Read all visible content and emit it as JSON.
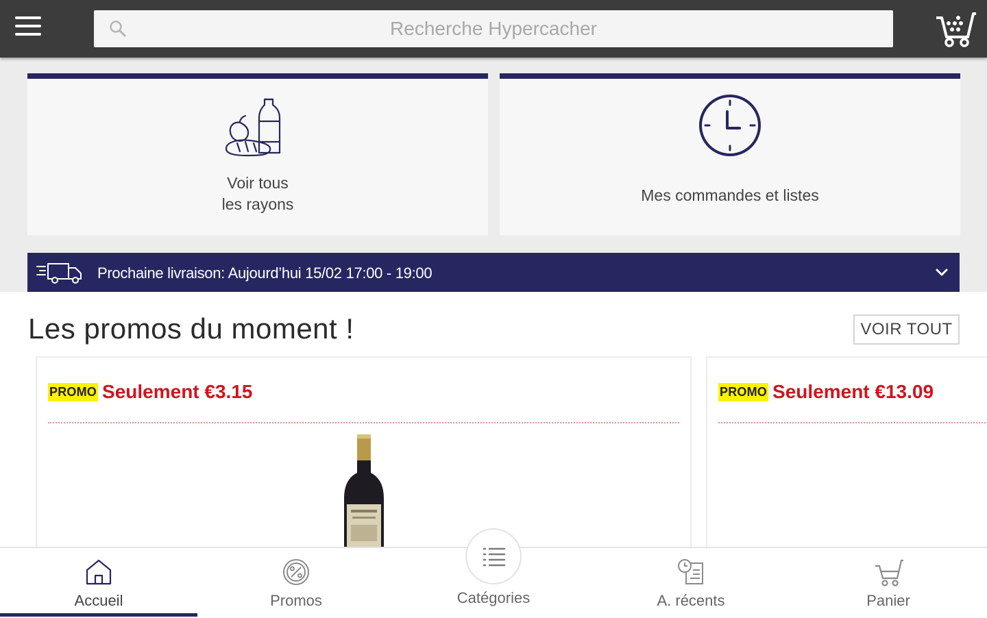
{
  "header": {
    "menu_icon": "hamburger-menu-icon",
    "search_placeholder": "Recherche Hypercacher",
    "cart_icon": "shopping-cart-icon"
  },
  "tiles": {
    "left": {
      "icon": "groceries-icon",
      "label_line1": "Voir tous",
      "label_line2": "les rayons"
    },
    "right": {
      "icon": "clock-icon",
      "label": "Mes commandes et listes"
    }
  },
  "delivery": {
    "icon": "delivery-truck-icon",
    "text": "Prochaine livraison: Aujourd’hui 15/02 17:00 - 19:00"
  },
  "promos": {
    "title": "Les promos du moment !",
    "see_all": "VOIR TOUT",
    "cards": [
      {
        "badge": "PROMO",
        "price": "Seulement €3.15"
      },
      {
        "badge": "PROMO",
        "price": "Seulement €13.09"
      }
    ]
  },
  "bottom_nav": {
    "items": [
      {
        "label": "Accueil",
        "icon": "home-icon",
        "active": true
      },
      {
        "label": "Promos",
        "icon": "percent-badge-icon"
      },
      {
        "label": "Catégories",
        "icon": "list-icon"
      },
      {
        "label": "A. récents",
        "icon": "recent-items-icon"
      },
      {
        "label": "Panier",
        "icon": "cart-icon"
      }
    ]
  },
  "colors": {
    "primary": "#262660",
    "promo_red": "#d0141f",
    "badge_yellow": "#fff200",
    "topbar": "#3c3c3c"
  }
}
